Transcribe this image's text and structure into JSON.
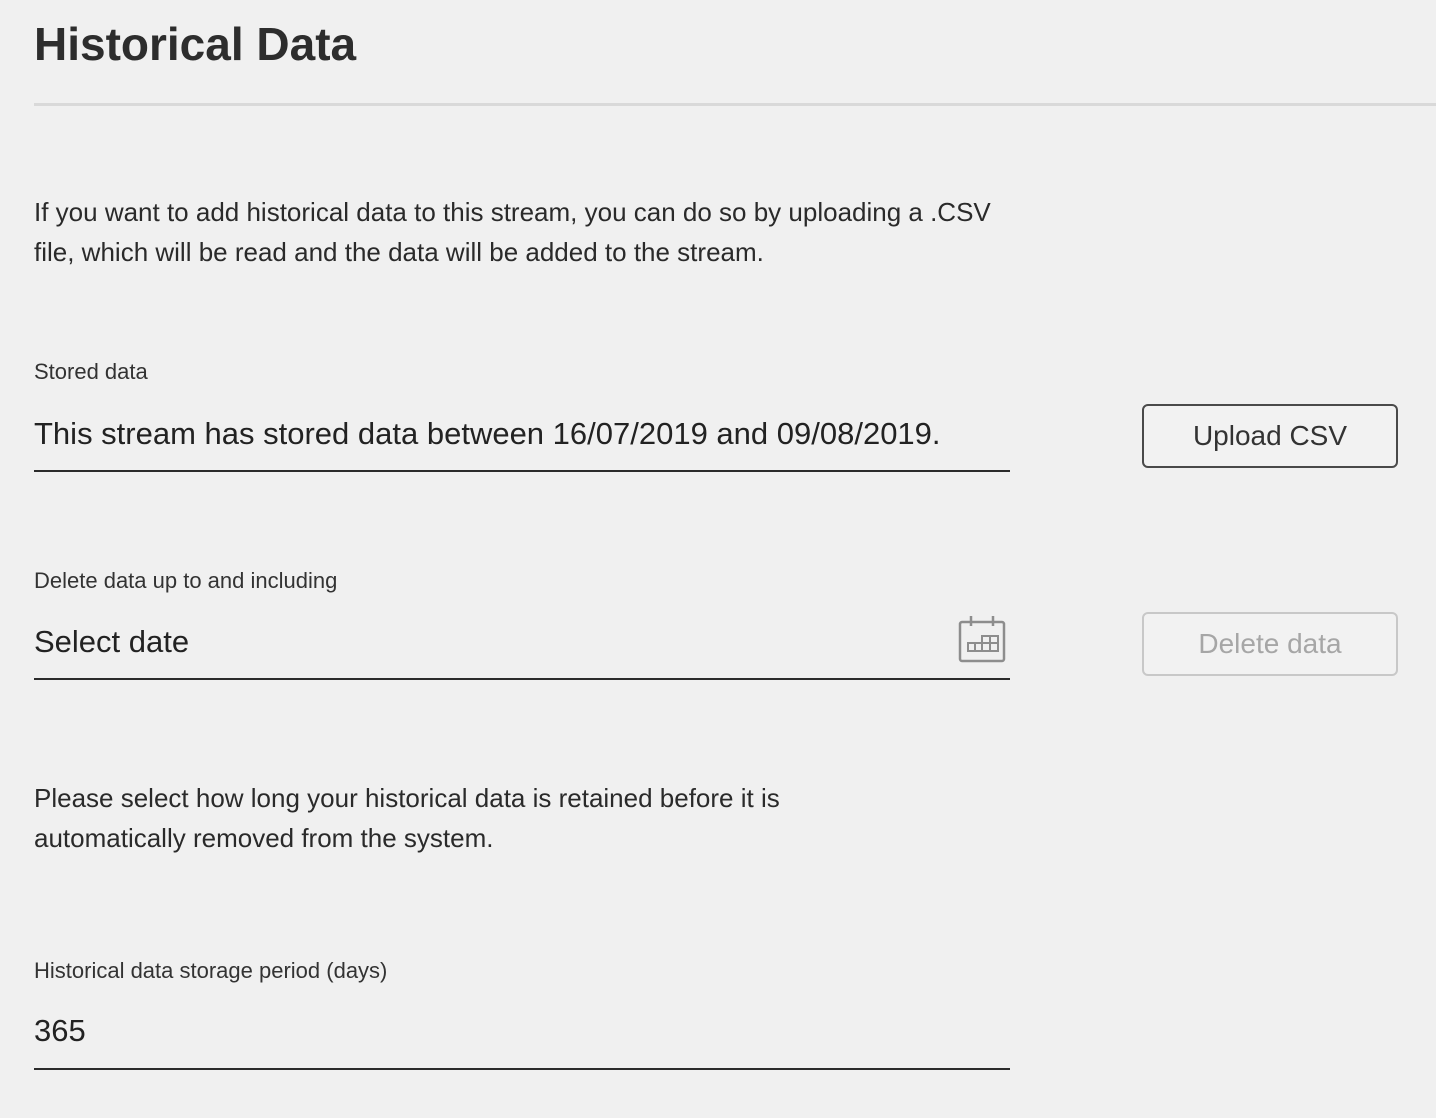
{
  "header": {
    "title": "Historical Data"
  },
  "intro": {
    "text": "If you want to add historical data to this stream, you can do so by uploading a .CSV file, which will be read and the data will be added to the stream."
  },
  "stored_data": {
    "label": "Stored data",
    "value": "This stream has stored data between 16/07/2019 and 09/08/2019.",
    "upload_button_label": "Upload CSV"
  },
  "delete_data": {
    "label": "Delete data up to and including",
    "date_placeholder": "Select date",
    "calendar_icon": "calendar-icon",
    "delete_button_label": "Delete data",
    "delete_button_disabled": true
  },
  "retention": {
    "text": "Please select how long your historical data is retained before it is automatically removed from the system."
  },
  "storage_period": {
    "label": "Historical data storage period (days)",
    "value": "365"
  },
  "colors": {
    "background": "#f0f0f0",
    "text": "#252525",
    "disabled_text": "#a6a6a6",
    "disabled_border": "#c8c8c8"
  }
}
